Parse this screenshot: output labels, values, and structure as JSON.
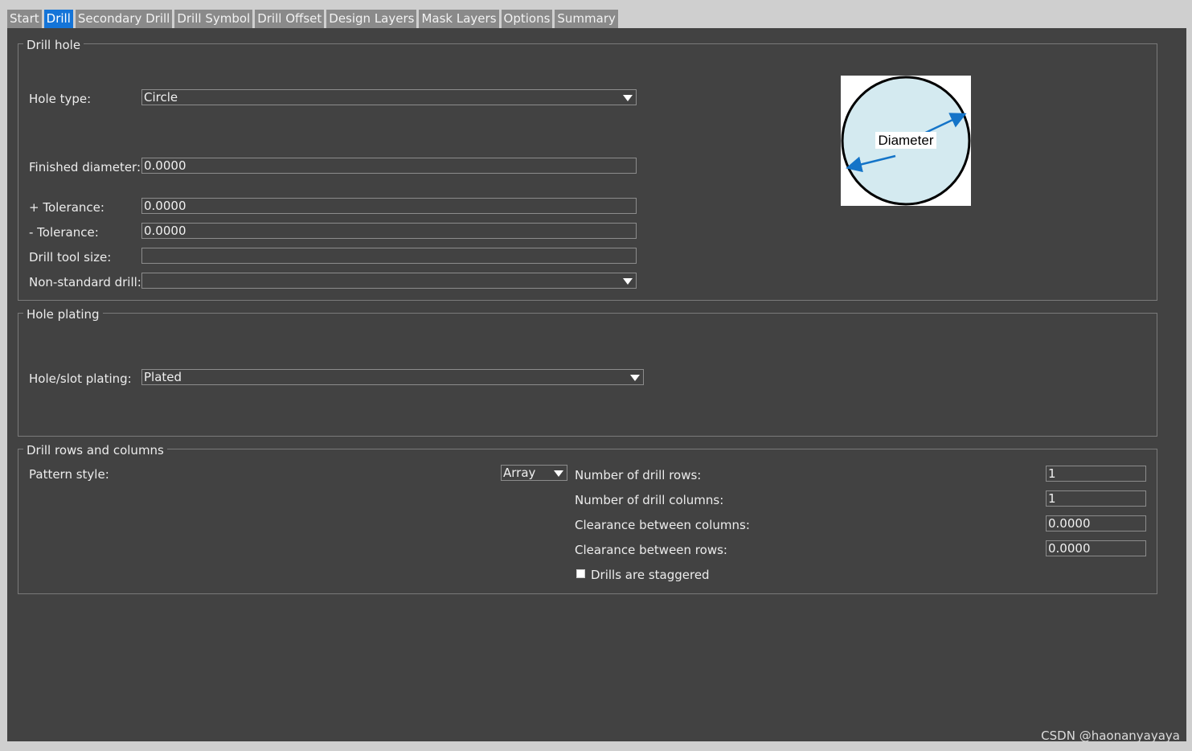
{
  "tabs": [
    {
      "label": "Start",
      "active": false
    },
    {
      "label": "Drill",
      "active": true
    },
    {
      "label": "Secondary Drill",
      "active": false
    },
    {
      "label": "Drill Symbol",
      "active": false
    },
    {
      "label": "Drill Offset",
      "active": false
    },
    {
      "label": "Design Layers",
      "active": false
    },
    {
      "label": "Mask Layers",
      "active": false
    },
    {
      "label": "Options",
      "active": false
    },
    {
      "label": "Summary",
      "active": false
    }
  ],
  "drill_hole": {
    "legend": "Drill hole",
    "hole_type": {
      "label": "Hole type:",
      "value": "Circle"
    },
    "finished_diameter": {
      "label": "Finished diameter:",
      "value": "0.0000"
    },
    "plus_tolerance": {
      "label": "+ Tolerance:",
      "value": "0.0000"
    },
    "minus_tolerance": {
      "label": "- Tolerance:",
      "value": "0.0000"
    },
    "drill_tool_size": {
      "label": "Drill tool size:",
      "value": ""
    },
    "non_standard_drill": {
      "label": "Non-standard drill:",
      "value": ""
    },
    "diagram_label": "Diameter"
  },
  "hole_plating": {
    "legend": "Hole plating",
    "plating": {
      "label": "Hole/slot plating:",
      "value": "Plated"
    }
  },
  "drill_rows": {
    "legend": "Drill rows and columns",
    "pattern_style": {
      "label": "Pattern style:",
      "value": "Array"
    },
    "rows": {
      "label": "Number of drill rows:",
      "value": "1"
    },
    "columns": {
      "label": "Number of drill columns:",
      "value": "1"
    },
    "clearance_columns": {
      "label": "Clearance between columns:",
      "value": "0.0000"
    },
    "clearance_rows": {
      "label": "Clearance between rows:",
      "value": "0.0000"
    },
    "staggered": {
      "label": "Drills are staggered",
      "checked": false
    }
  },
  "watermark": "CSDN @haonanyayaya",
  "colors": {
    "panel_bg": "#424242",
    "active_tab": "#1474d8",
    "inactive_tab": "#8a8a8a",
    "diagram_fill": "#d4eaf0",
    "diagram_arrow": "#1474c8"
  }
}
